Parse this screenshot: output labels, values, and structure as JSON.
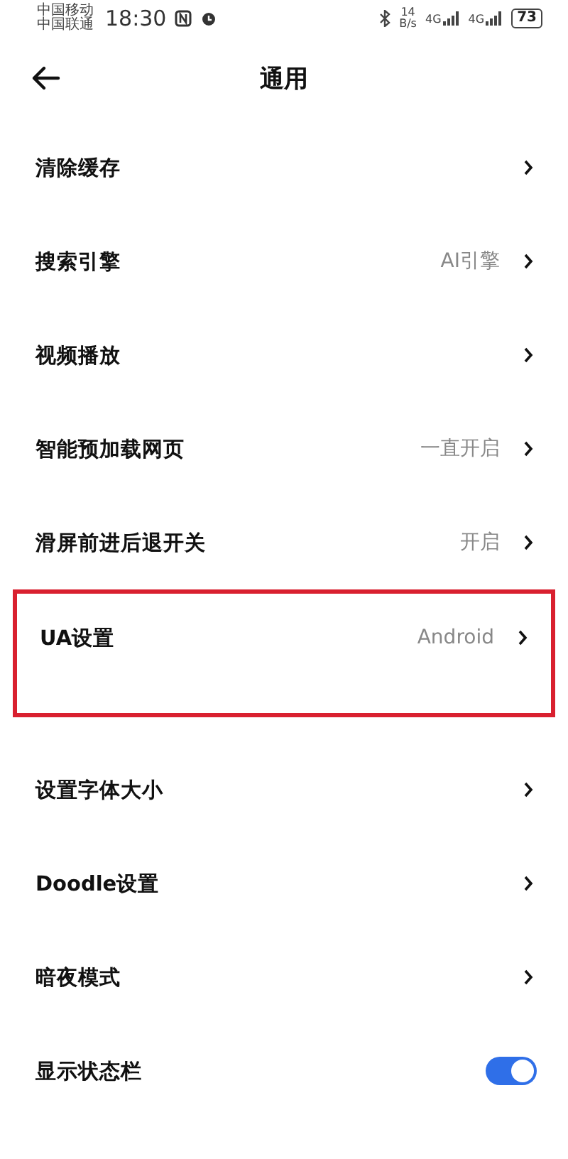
{
  "status_bar": {
    "carriers": [
      "中国移动",
      "中国联通"
    ],
    "time": "18:30",
    "speed": [
      "14",
      "B/s"
    ],
    "signals": [
      "4G",
      "4G"
    ],
    "battery": "73"
  },
  "header": {
    "title": "通用"
  },
  "items": [
    {
      "kind": "link",
      "label": "清除缓存",
      "highlighted": false
    },
    {
      "kind": "link",
      "label": "搜索引擎",
      "value": "AI引擎",
      "highlighted": false
    },
    {
      "kind": "link",
      "label": "视频播放",
      "highlighted": false
    },
    {
      "kind": "link",
      "label": "智能预加载网页",
      "value": "一直开启",
      "highlighted": false
    },
    {
      "kind": "link",
      "label": "滑屏前进后退开关",
      "value": "开启",
      "highlighted": false
    },
    {
      "kind": "link",
      "label": "UA设置",
      "value": "Android",
      "highlighted": true
    },
    {
      "kind": "link",
      "label": "设置字体大小",
      "highlighted": false
    },
    {
      "kind": "link",
      "label": "Doodle设置",
      "highlighted": false
    },
    {
      "kind": "link",
      "label": "暗夜模式",
      "highlighted": false
    },
    {
      "kind": "switch",
      "label": "显示状态栏",
      "on": true,
      "highlighted": false
    }
  ]
}
